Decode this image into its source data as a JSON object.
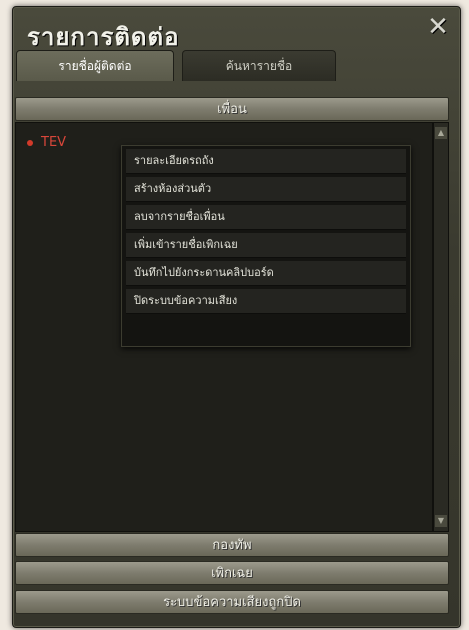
{
  "window": {
    "title": "รายการติดต่อ",
    "close_label": "✕"
  },
  "tabs": [
    {
      "label": "รายชื่อผู้ติดต่อ",
      "active": true
    },
    {
      "label": "ค้นหารายชื่อ",
      "active": false
    }
  ],
  "sections": {
    "friends": "เพื่อน",
    "guild": "กองทัพ",
    "ignored": "เพิกเฉย",
    "voice_blocked": "ระบบข้อความเสียงถูกปิด"
  },
  "contacts": [
    {
      "name": "TEV",
      "status_color": "#d23a2a"
    }
  ],
  "context_menu": {
    "items": [
      "รายละเอียดรถถัง",
      "สร้างห้องส่วนตัว",
      "ลบจากรายชื่อเพื่อน",
      "เพิ่มเข้ารายชื่อเพิกเฉย",
      "บันทึกไปยังกระดานคลิปบอร์ด",
      "ปิดระบบข้อความเสียง"
    ]
  },
  "scrollbar": {
    "up_icon": "arrow-up-icon",
    "down_icon": "arrow-down-icon"
  }
}
